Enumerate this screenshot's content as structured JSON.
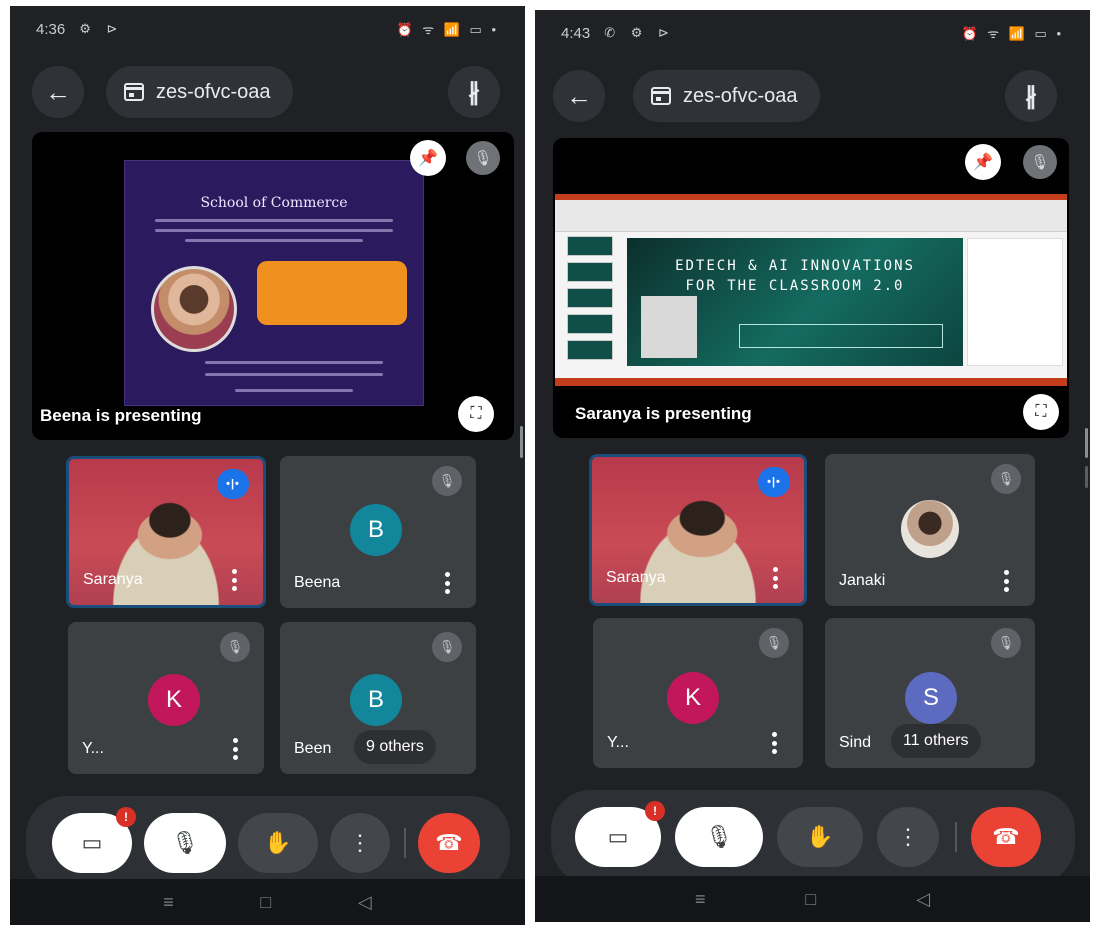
{
  "left": {
    "status": {
      "time": "4:36",
      "icons": "⚙ ⊳",
      "right": "⏰ ᯤ 📶 ▭ •"
    },
    "meeting_code": "zes-ofvc-oaa",
    "presenting": "Beena is presenting",
    "poster": {
      "title": "School of Commerce"
    },
    "tiles": [
      {
        "name": "Saranya",
        "type": "video"
      },
      {
        "name": "Beena",
        "type": "avatar",
        "initial": "B",
        "color": "#12869a"
      },
      {
        "name": "Y...",
        "type": "avatar",
        "initial": "K",
        "color": "#c2185b"
      },
      {
        "name": "Been",
        "type": "avatar",
        "initial": "B",
        "color": "#12869a",
        "others": "9 others"
      }
    ],
    "camera_badge": "!"
  },
  "right": {
    "status": {
      "time": "4:43",
      "icons": "✆ ⚙ ⊳",
      "right": "⏰ ᯤ 📶 ▭ •"
    },
    "meeting_code": "zes-ofvc-oaa",
    "presenting": "Saranya is presenting",
    "slide": {
      "line1": "EDTECH & AI INNOVATIONS",
      "line2": "FOR THE CLASSROOM 2.0"
    },
    "tiles": [
      {
        "name": "Saranya",
        "type": "video"
      },
      {
        "name": "Janaki",
        "type": "photo"
      },
      {
        "name": "Y...",
        "type": "avatar",
        "initial": "K",
        "color": "#c2185b"
      },
      {
        "name": "Sind",
        "type": "avatar",
        "initial": "S",
        "color": "#5c6bc0",
        "others": "11 others"
      }
    ],
    "camera_badge": "!"
  },
  "icons": {
    "back": "←",
    "bluetooth": "∦",
    "pin": "📌",
    "mic_off": "🎙",
    "fullscreen": "⛶",
    "camera_off": "▭",
    "raise_hand": "✋",
    "more": "⋮",
    "end_call": "☎",
    "nav_menu": "≡",
    "nav_home": "□",
    "nav_back": "◁"
  },
  "colors": {
    "bg": "#1f2125",
    "tile": "#3c4043",
    "end_call": "#ea4335",
    "speaking": "#1a73e8"
  }
}
